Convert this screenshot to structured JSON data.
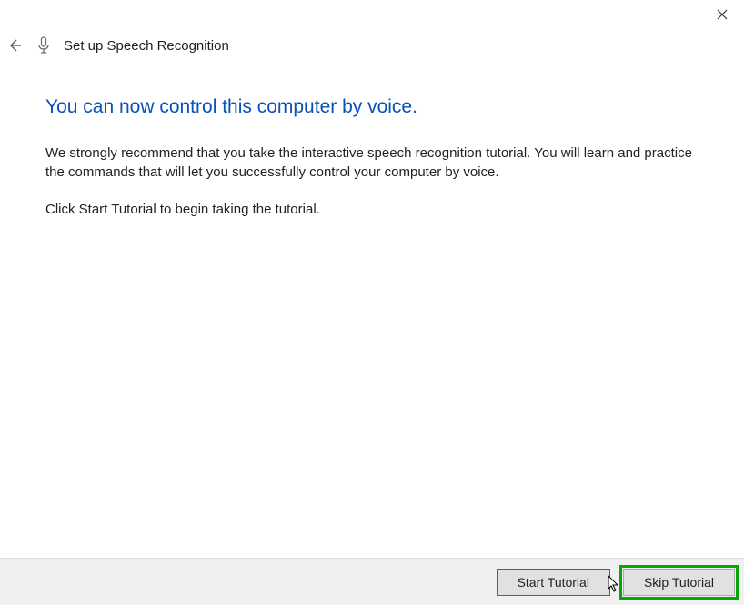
{
  "header": {
    "title": "Set up Speech Recognition"
  },
  "main": {
    "heading": "You can now control this computer by voice.",
    "paragraph1": "We strongly recommend that you take the interactive speech recognition tutorial. You will learn and practice the commands that will let you successfully control your computer by voice.",
    "paragraph2": "Click Start Tutorial to begin taking the tutorial."
  },
  "buttons": {
    "start": "Start Tutorial",
    "skip": "Skip Tutorial"
  }
}
